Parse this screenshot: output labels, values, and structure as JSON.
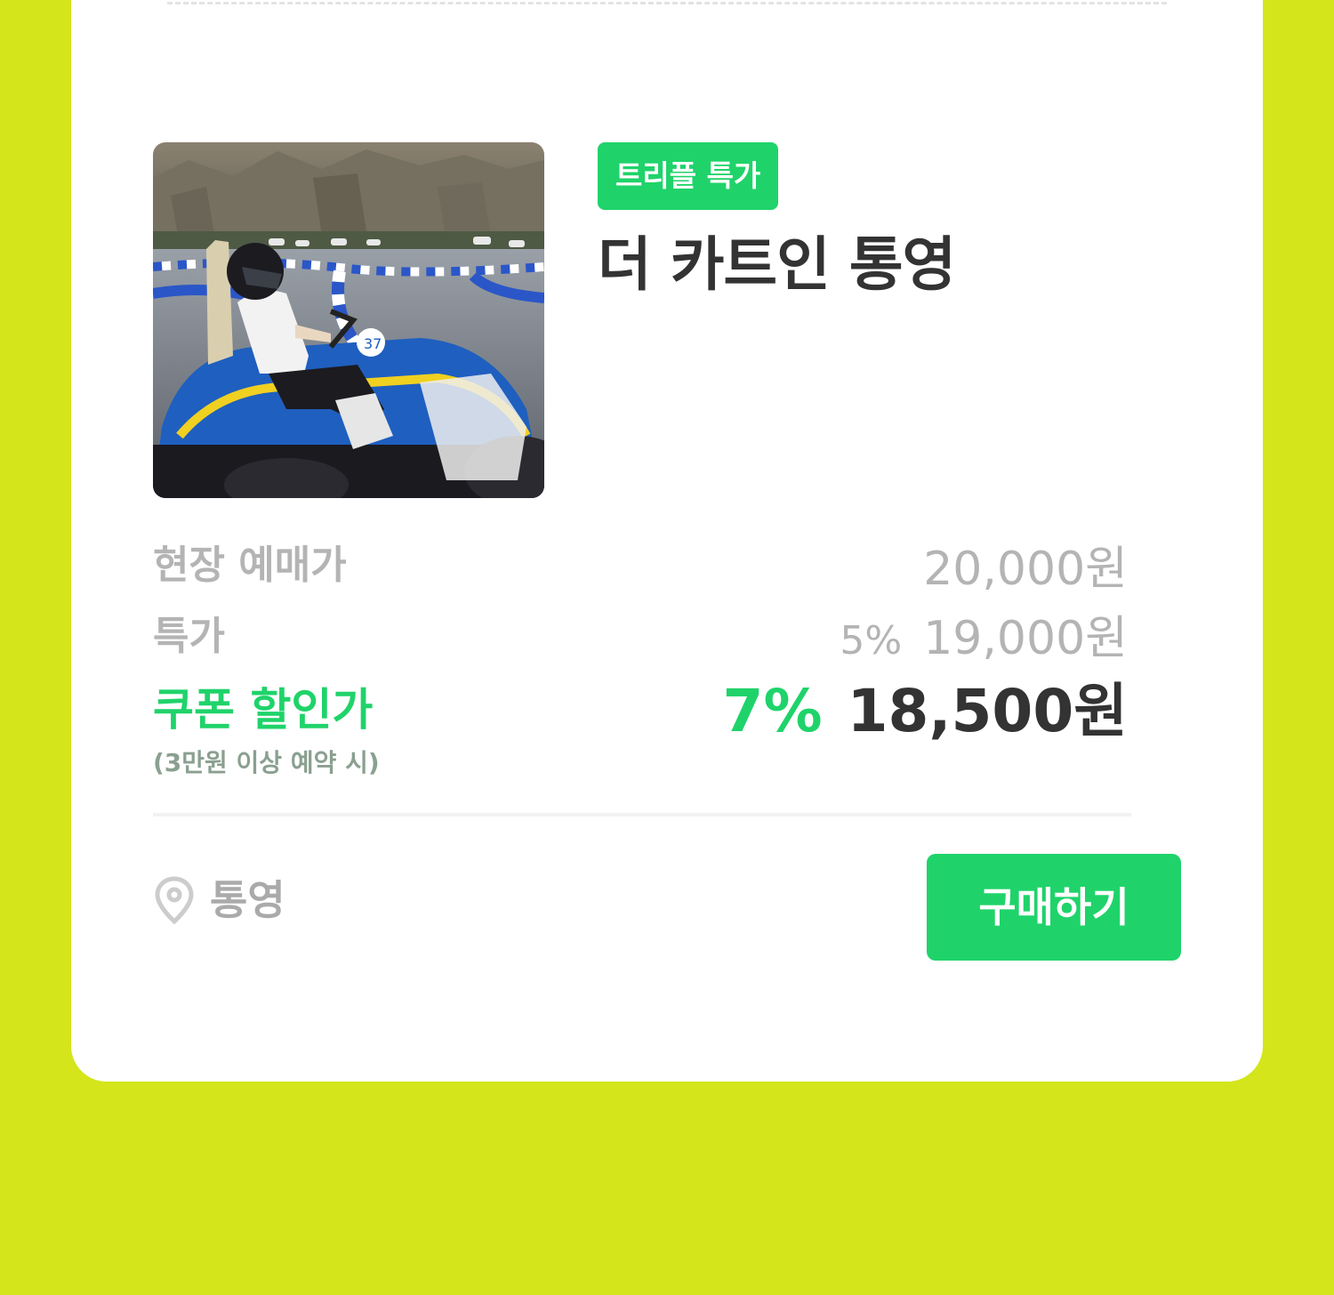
{
  "product": {
    "badge": "트리플 특가",
    "title": "더 카트인 통영",
    "image_label": "go-kart driver on track"
  },
  "pricing": {
    "regular_label": "현장 예매가",
    "regular_price": "20,000원",
    "special_label": "특가",
    "special_discount": "5%",
    "special_price": "19,000원",
    "coupon_label": "쿠폰 할인가",
    "coupon_condition": "(3만원 이상 예약 시)",
    "coupon_discount": "7%",
    "coupon_price": "18,500원"
  },
  "footer": {
    "location_icon": "location-pin-icon",
    "location": "통영",
    "buy_label": "구매하기"
  },
  "colors": {
    "background": "#d4e51b",
    "accent_green": "#1fd36a",
    "text_dark": "#333333",
    "text_gray": "#b4b4b4"
  }
}
